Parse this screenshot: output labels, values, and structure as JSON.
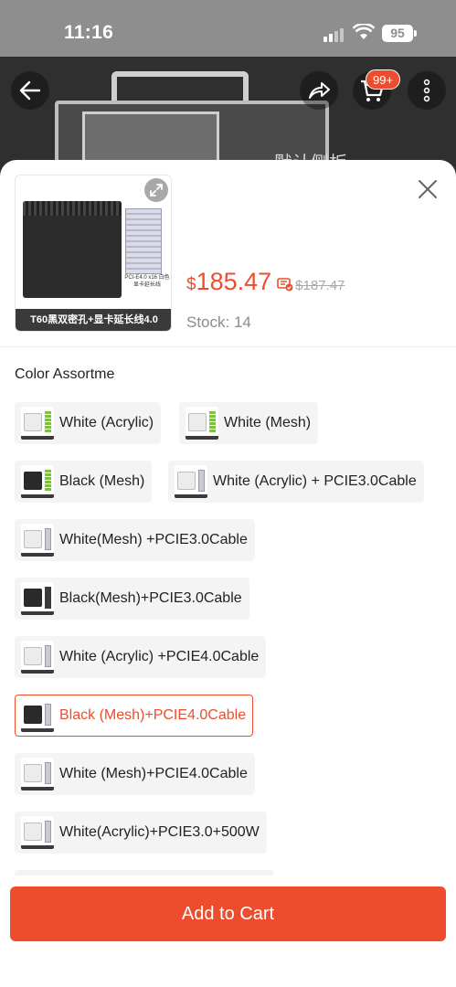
{
  "status_bar": {
    "time": "11:16",
    "battery": "95"
  },
  "backdrop": {
    "overlay_text": "默认侧板",
    "cart_badge": "99+"
  },
  "product": {
    "thumbnail_caption": "T60黑双密孔+显卡延长线4.0",
    "thumbnail_cable_text": "PCI-E4.0 x16 白色显卡延长线",
    "currency": "$",
    "price": "185.47",
    "original_price": "$187.47",
    "stock": "Stock: 14"
  },
  "variation": {
    "label": "Color Assortme",
    "options": [
      {
        "label": "White (Acrylic)",
        "swatch": "white-case-green",
        "selected": false
      },
      {
        "label": "White (Mesh)",
        "swatch": "white-case-green",
        "selected": false
      },
      {
        "label": "Black (Mesh)",
        "swatch": "black-case-green",
        "selected": false
      },
      {
        "label": "White (Acrylic) + PCIE3.0Cable",
        "swatch": "white-case-cable",
        "selected": false
      },
      {
        "label": "White(Mesh) +PCIE3.0Cable",
        "swatch": "white-case-cable",
        "selected": false
      },
      {
        "label": "Black(Mesh)+PCIE3.0Cable",
        "swatch": "black-case-cable",
        "selected": false
      },
      {
        "label": "White (Acrylic) +PCIE4.0Cable",
        "swatch": "white-case-cable",
        "selected": false
      },
      {
        "label": "Black (Mesh)+PCIE4.0Cable",
        "swatch": "black-case-cable",
        "selected": true
      },
      {
        "label": "White (Mesh)+PCIE4.0Cable",
        "swatch": "white-case-cable",
        "selected": false
      },
      {
        "label": "White(Acrylic)+PCIE3.0+500W",
        "swatch": "white-case-cable",
        "selected": false
      }
    ]
  },
  "footer": {
    "add_to_cart": "Add to Cart"
  },
  "colors": {
    "accent": "#ee4d2d",
    "option_bg": "#f4f4f4",
    "muted": "#8c8c8c"
  },
  "icons": [
    "back-arrow-icon",
    "share-icon",
    "cart-icon",
    "more-icon",
    "expand-icon",
    "close-icon",
    "coin-icon"
  ]
}
